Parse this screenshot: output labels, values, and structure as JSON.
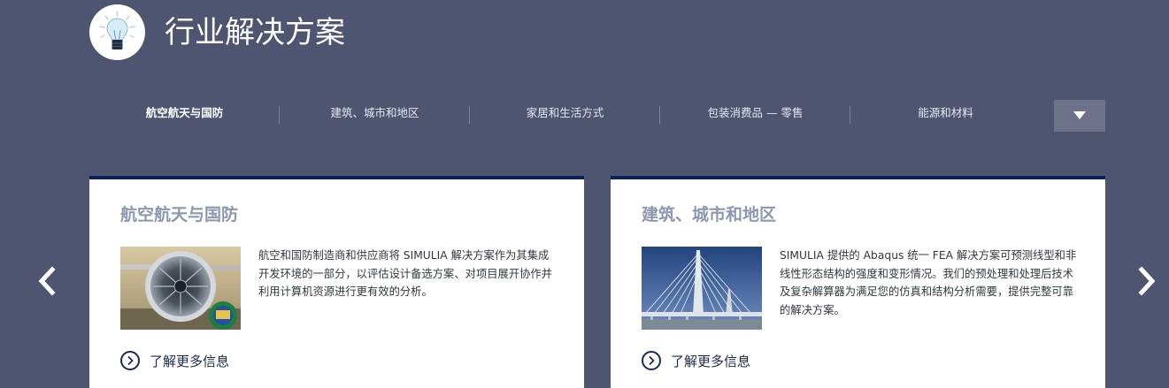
{
  "header": {
    "icon": "lightbulb-icon",
    "title": "行业解决方案"
  },
  "tabs": [
    {
      "label": "航空航天与国防",
      "active": true
    },
    {
      "label": "建筑、城市和地区",
      "active": false
    },
    {
      "label": "家居和生活方式",
      "active": false
    },
    {
      "label": "包装消费品 — 零售",
      "active": false
    },
    {
      "label": "能源和材料",
      "active": false
    }
  ],
  "more_button": {
    "icon": "triangle-down-icon"
  },
  "nav": {
    "prev_icon": "chevron-left-icon",
    "next_icon": "chevron-right-icon"
  },
  "cards": [
    {
      "title": "航空航天与国防",
      "image": "jet-engine-photo",
      "text": "航空和国防制造商和供应商将 SIMULIA 解决方案作为其集成开发环境的一部分，以评估设计备选方案、对项目展开协作并利用计算机资源进行更有效的分析。",
      "more_label": "了解更多信息",
      "more_icon": "circle-chevron-right-icon"
    },
    {
      "title": "建筑、城市和地区",
      "image": "cable-stayed-bridge-photo",
      "text": "SIMULIA 提供的 Abaqus 统一 FEA 解决方案可预测线型和非线性形态结构的强度和变形情况。我们的预处理和处理后技术及复杂解算器为满足您的仿真和结构分析需要，提供完整可靠的解决方案。",
      "more_label": "了解更多信息",
      "more_icon": "circle-chevron-right-icon"
    }
  ],
  "colors": {
    "background": "#4f5470",
    "card_accent": "#0c1f5f",
    "card_title": "#8d98b0",
    "link": "#1a2b4a"
  }
}
